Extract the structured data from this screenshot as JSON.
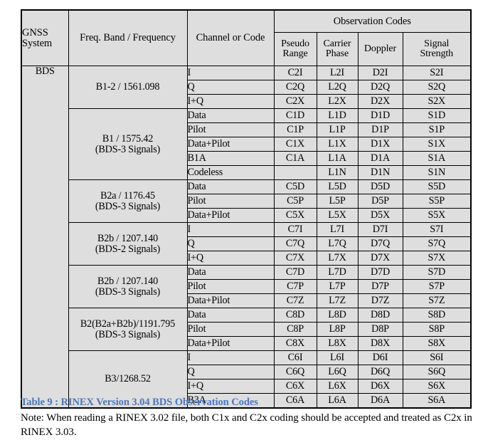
{
  "table": {
    "headers": {
      "gnss_system": "GNSS System",
      "gnss_system_line1": "GNSS",
      "gnss_system_line2": "System",
      "freq_band": "Freq. Band / Frequency",
      "channel_or_code": "Channel or Code",
      "observation_codes": "Observation Codes",
      "pseudo_range_line1": "Pseudo",
      "pseudo_range_line2": "Range",
      "carrier_phase_line1": "Carrier",
      "carrier_phase_line2": "Phase",
      "doppler": "Doppler",
      "signal_strength_line1": "Signal",
      "signal_strength_line2": "Strength"
    },
    "system": "BDS",
    "groups": [
      {
        "band_line1": "B1-2 / 1561.098",
        "band_line2": "",
        "rows": [
          {
            "channel": "I",
            "pseudo_range": "C2I",
            "carrier_phase": "L2I",
            "doppler": "D2I",
            "signal_strength": "S2I"
          },
          {
            "channel": "Q",
            "pseudo_range": "C2Q",
            "carrier_phase": "L2Q",
            "doppler": "D2Q",
            "signal_strength": "S2Q"
          },
          {
            "channel": "I+Q",
            "pseudo_range": "C2X",
            "carrier_phase": "L2X",
            "doppler": "D2X",
            "signal_strength": "S2X"
          }
        ]
      },
      {
        "band_line1": "B1 / 1575.42",
        "band_line2": "(BDS-3 Signals)",
        "rows": [
          {
            "channel": "Data",
            "pseudo_range": "C1D",
            "carrier_phase": "L1D",
            "doppler": "D1D",
            "signal_strength": "S1D"
          },
          {
            "channel": "Pilot",
            "pseudo_range": "C1P",
            "carrier_phase": "L1P",
            "doppler": "D1P",
            "signal_strength": "S1P"
          },
          {
            "channel": "Data+Pilot",
            "pseudo_range": "C1X",
            "carrier_phase": "L1X",
            "doppler": "D1X",
            "signal_strength": "S1X"
          },
          {
            "channel": "B1A",
            "pseudo_range": "C1A",
            "carrier_phase": "L1A",
            "doppler": "D1A",
            "signal_strength": "S1A"
          },
          {
            "channel": "Codeless",
            "pseudo_range": "",
            "carrier_phase": "L1N",
            "doppler": "D1N",
            "signal_strength": "S1N"
          }
        ]
      },
      {
        "band_line1": "B2a / 1176.45",
        "band_line2": "(BDS-3 Signals)",
        "rows": [
          {
            "channel": "Data",
            "pseudo_range": "C5D",
            "carrier_phase": "L5D",
            "doppler": "D5D",
            "signal_strength": "S5D"
          },
          {
            "channel": "Pilot",
            "pseudo_range": "C5P",
            "carrier_phase": "L5P",
            "doppler": "D5P",
            "signal_strength": "S5P"
          },
          {
            "channel": "Data+Pilot",
            "pseudo_range": "C5X",
            "carrier_phase": "L5X",
            "doppler": "D5X",
            "signal_strength": "S5X"
          }
        ]
      },
      {
        "band_line1": "B2b / 1207.140",
        "band_line2": "(BDS-2 Signals)",
        "rows": [
          {
            "channel": "I",
            "pseudo_range": "C7I",
            "carrier_phase": "L7I",
            "doppler": "D7I",
            "signal_strength": "S7I"
          },
          {
            "channel": "Q",
            "pseudo_range": "C7Q",
            "carrier_phase": "L7Q",
            "doppler": "D7Q",
            "signal_strength": "S7Q"
          },
          {
            "channel": "I+Q",
            "pseudo_range": "C7X",
            "carrier_phase": "L7X",
            "doppler": "D7X",
            "signal_strength": "S7X"
          }
        ]
      },
      {
        "band_line1": "B2b / 1207.140",
        "band_line2": "(BDS-3 Signals)",
        "rows": [
          {
            "channel": "Data",
            "pseudo_range": "C7D",
            "carrier_phase": "L7D",
            "doppler": "D7D",
            "signal_strength": "S7D"
          },
          {
            "channel": "Pilot",
            "pseudo_range": "C7P",
            "carrier_phase": "L7P",
            "doppler": "D7P",
            "signal_strength": "S7P"
          },
          {
            "channel": "Data+Pilot",
            "pseudo_range": "C7Z",
            "carrier_phase": "L7Z",
            "doppler": "D7Z",
            "signal_strength": "S7Z"
          }
        ]
      },
      {
        "band_line1": "B2(B2a+B2b)/1191.795",
        "band_line2": "(BDS-3 Signals)",
        "rows": [
          {
            "channel": "Data",
            "pseudo_range": "C8D",
            "carrier_phase": "L8D",
            "doppler": "D8D",
            "signal_strength": "S8D"
          },
          {
            "channel": "Pilot",
            "pseudo_range": "C8P",
            "carrier_phase": "L8P",
            "doppler": "D8P",
            "signal_strength": "S8P"
          },
          {
            "channel": "Data+Pilot",
            "pseudo_range": "C8X",
            "carrier_phase": "L8X",
            "doppler": "D8X",
            "signal_strength": "S8X"
          }
        ]
      },
      {
        "band_line1": "B3/1268.52",
        "band_line2": "",
        "rows": [
          {
            "channel": "I",
            "pseudo_range": "C6I",
            "carrier_phase": "L6I",
            "doppler": "D6I",
            "signal_strength": "S6I"
          },
          {
            "channel": "Q",
            "pseudo_range": "C6Q",
            "carrier_phase": "L6Q",
            "doppler": "D6Q",
            "signal_strength": "S6Q"
          },
          {
            "channel": "I+Q",
            "pseudo_range": "C6X",
            "carrier_phase": "L6X",
            "doppler": "D6X",
            "signal_strength": "S6X"
          },
          {
            "channel": "B3A",
            "pseudo_range": "C6A",
            "carrier_phase": "L6A",
            "doppler": "D6A",
            "signal_strength": "S6A"
          }
        ]
      }
    ]
  },
  "caption": "Table 9 : RINEX Version 3.04 BDS Observation Codes",
  "note": "Note: When reading a RINEX 3.02 file, both C1x and C2x coding should be accepted and treated as C2x in RINEX 3.03.",
  "colors": {
    "caption": "#4a79bd",
    "cell_background": "#dedede",
    "border": "#000000",
    "page_background": "#ffffff"
  }
}
